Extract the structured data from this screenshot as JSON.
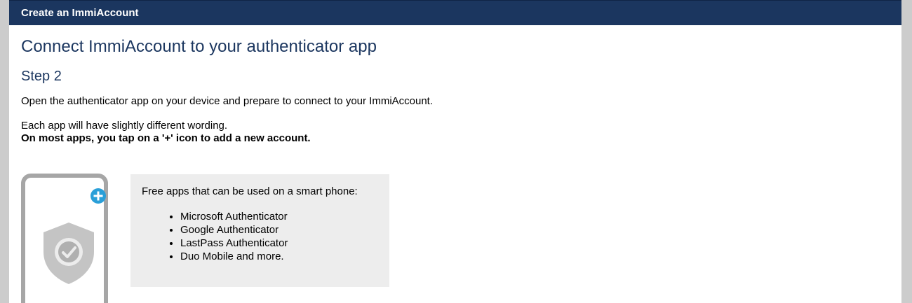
{
  "header": {
    "title": "Create an ImmiAccount"
  },
  "main": {
    "page_title": "Connect ImmiAccount to your authenticator app",
    "step_title": "Step 2",
    "paragraph_1": "Open the authenticator app on your device and prepare to connect to your ImmiAccount.",
    "paragraph_2": "Each app will have slightly different wording.",
    "paragraph_3_bold": "On most apps, you tap on a '+' icon to add a new account."
  },
  "info_box": {
    "intro": "Free apps that can be used on a smart phone:",
    "apps": [
      "Microsoft Authenticator",
      "Google Authenticator",
      "LastPass Authenticator",
      "Duo Mobile and more."
    ]
  },
  "illustration": {
    "icons": [
      "plus-icon",
      "shield-check-icon"
    ]
  },
  "colors": {
    "header_bg": "#1b365f",
    "title_color": "#1b365f",
    "plus_icon": "#2a9fd8",
    "info_bg": "#ededed",
    "phone_border": "#a6a6a6"
  }
}
